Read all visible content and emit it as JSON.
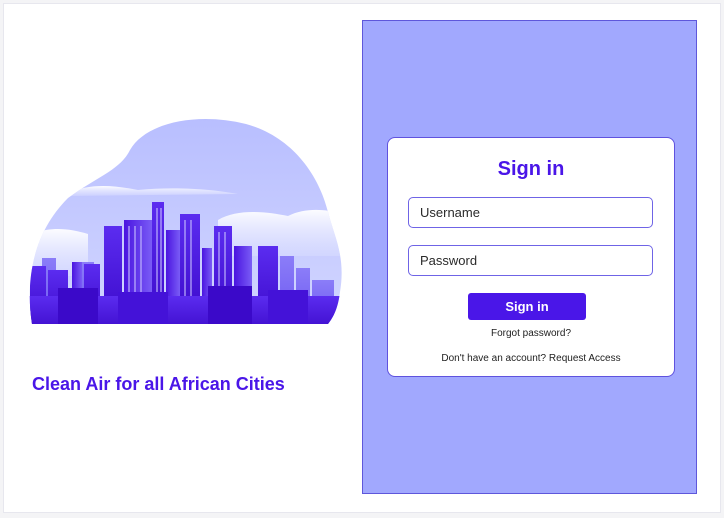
{
  "hero": {
    "tagline": "Clean Air for all African Cities"
  },
  "login": {
    "title": "Sign in",
    "username_placeholder": "Username",
    "password_placeholder": "Password",
    "submit_label": "Sign in",
    "forgot_password_label": "Forgot password?",
    "no_account_text": "Don't have an account?",
    "request_access_label": "Request Access"
  },
  "colors": {
    "brand_primary": "#4a16e8",
    "panel_background": "#a1a8fe",
    "hero_sky": "#c7ccff"
  }
}
